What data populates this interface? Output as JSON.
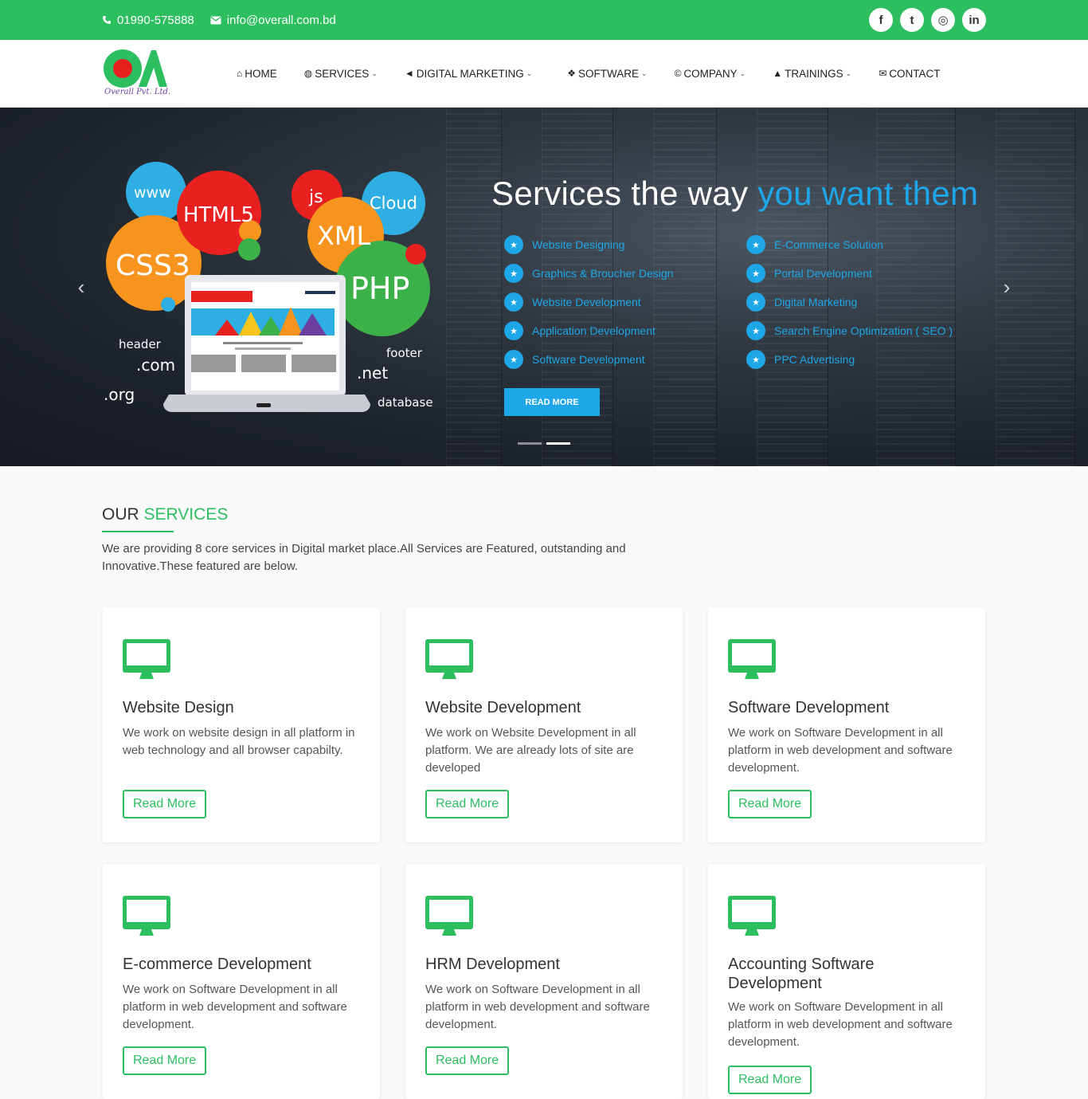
{
  "topbar": {
    "phone": "01990-575888",
    "email": "info@overall.com.bd",
    "social": [
      {
        "name": "facebook-icon",
        "glyph": "f"
      },
      {
        "name": "twitter-icon",
        "glyph": "t"
      },
      {
        "name": "instagram-icon",
        "glyph": "◎"
      },
      {
        "name": "linkedin-icon",
        "glyph": "in"
      }
    ]
  },
  "logo": {
    "tagline": "Overall Pvt. Ltd."
  },
  "nav": [
    {
      "label": "HOME",
      "icon": "home-icon",
      "glyph": "⌂",
      "dropdown": false
    },
    {
      "label": "SERVICES",
      "icon": "globe-icon",
      "glyph": "◍",
      "dropdown": true
    },
    {
      "label": "DIGITAL MARKETING",
      "icon": "bullhorn-icon",
      "glyph": "◄",
      "dropdown": true
    },
    {
      "label": "SOFTWARE",
      "icon": "cubes-icon",
      "glyph": "❖",
      "dropdown": true
    },
    {
      "label": "COMPANY",
      "icon": "copyright-icon",
      "glyph": "©",
      "dropdown": true
    },
    {
      "label": "TRAININGS",
      "icon": "graduation-cap-icon",
      "glyph": "▲",
      "dropdown": true
    },
    {
      "label": "CONTACT",
      "icon": "envelope-icon",
      "glyph": "✉",
      "dropdown": false
    }
  ],
  "hero": {
    "title_part1": "Services the way ",
    "title_accent": "you want them",
    "services_left": [
      "Website Designing",
      "Graphics & Broucher Design",
      "Website Development",
      "Application Development",
      "Software Development"
    ],
    "services_right": [
      "E-Commerce Solution",
      "Portal Development",
      "Digital Marketing",
      "Search Engine Optimization ( SEO )",
      "PPC Advertising"
    ],
    "button": "READ MORE",
    "illustration": {
      "bubbles": [
        "www",
        "HTML5",
        "js",
        "Cloud",
        "CSS3",
        "XML",
        "PHP"
      ],
      "labels": [
        "header",
        ".com",
        ".org",
        "footer",
        ".net",
        "database"
      ]
    },
    "slides": 2,
    "active_slide": 2
  },
  "services_section": {
    "title_part1": "OUR ",
    "title_part2": "SERVICES",
    "description": "We are providing 8 core services in Digital market place.All Services are Featured, outstanding and Innovative.These featured are below.",
    "cards": [
      {
        "title": "Website Design",
        "desc": "We work on website design in all platform in web technology and all browser capabilty.",
        "button": "Read More"
      },
      {
        "title": "Website Development",
        "desc": "We work on Website Development in all platform. We are already lots of site are developed",
        "button": "Read More"
      },
      {
        "title": "Software Development",
        "desc": "We work on Software Development in all platform in web development and software development.",
        "button": "Read More"
      },
      {
        "title": "E-commerce Development",
        "desc": "We work on Software Development in all platform in web development and software development.",
        "button": "Read More"
      },
      {
        "title": "HRM Development",
        "desc": "We work on Software Development in all platform in web development and software development.",
        "button": "Read More"
      },
      {
        "title": "Accounting Software Development",
        "desc": "We work on Software Development in all platform in web development and software development.",
        "button": "Read More"
      }
    ]
  },
  "colors": {
    "brand_green": "#2dbe60",
    "accent_blue": "#1ea7e8"
  }
}
